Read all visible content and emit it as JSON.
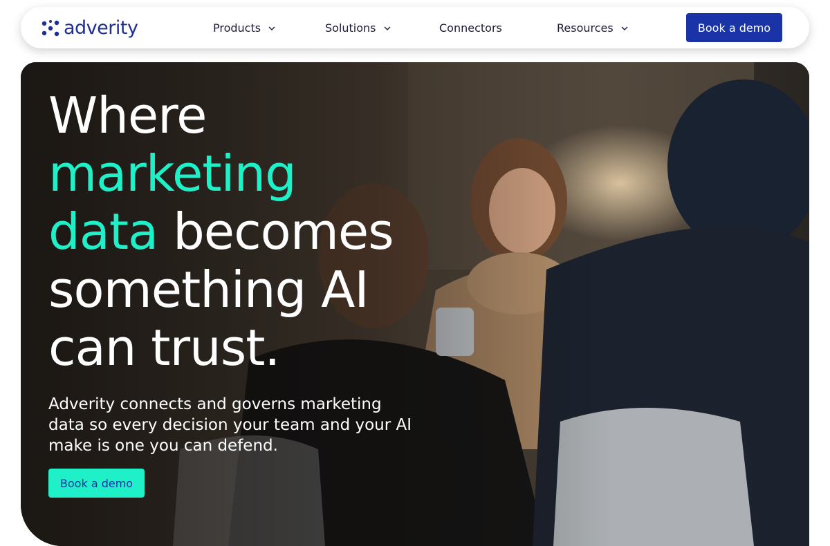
{
  "brand": {
    "name": "adverity",
    "logo_icon": "adverity-logo-icon",
    "color": "#1e2f8f"
  },
  "nav": {
    "items": [
      {
        "label": "Products",
        "has_dropdown": true
      },
      {
        "label": "Solutions",
        "has_dropdown": true
      },
      {
        "label": "Connectors",
        "has_dropdown": false
      },
      {
        "label": "Resources",
        "has_dropdown": true
      }
    ],
    "cta_label": "Book a demo"
  },
  "hero": {
    "headline": {
      "line1": "Where",
      "accent1": "marketing",
      "accent2": "data",
      "rest2": " becomes",
      "line4": "something AI",
      "line5": "can trust."
    },
    "subtext": "Adverity connects and governs marketing data so every decision your team and your AI make is one you can defend.",
    "cta_label": "Book a demo",
    "image": "people-meeting-photo"
  },
  "colors": {
    "primary": "#1a33a6",
    "accent": "#1ff0c8"
  }
}
